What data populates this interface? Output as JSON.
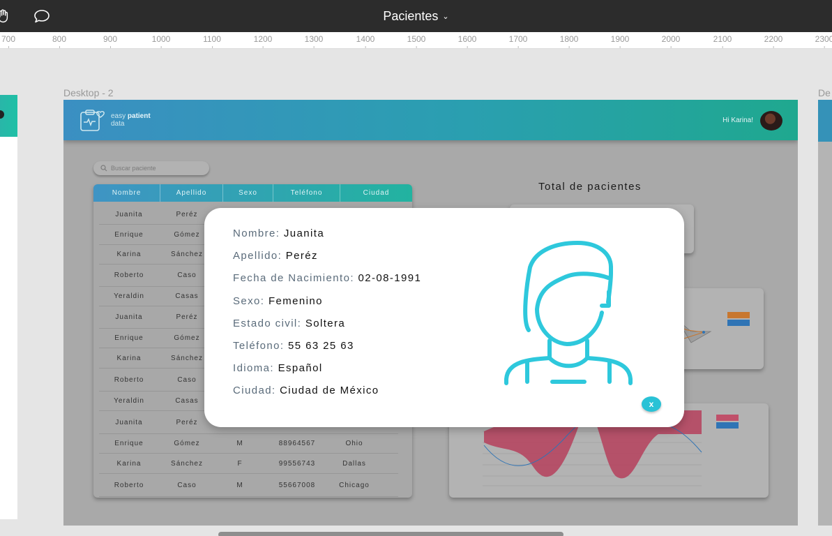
{
  "toolbar": {
    "title": "Pacientes",
    "caret": "⌄"
  },
  "ruler": [
    "700",
    "800",
    "900",
    "1000",
    "1100",
    "1200",
    "1300",
    "1400",
    "1500",
    "1600",
    "1700",
    "1800",
    "1900",
    "2000",
    "2100",
    "2200",
    "2300"
  ],
  "frames": {
    "main_label": "Desktop - 2",
    "right_label": "De"
  },
  "app": {
    "brand_line1_light": "easy ",
    "brand_line1_bold": "patient",
    "brand_line2": "data",
    "greeting": "Hi Karina!",
    "search_placeholder": "Buscar paciente",
    "table": {
      "headers": [
        "Nombre",
        "Apellido",
        "Sexo",
        "Teléfono",
        "Ciudad"
      ],
      "rows": [
        [
          "Juanita",
          "Peréz",
          "",
          "",
          ""
        ],
        [
          "Enrique",
          "Gómez",
          "",
          "",
          ""
        ],
        [
          "Karina",
          "Sánchez",
          "",
          "",
          ""
        ],
        [
          "Roberto",
          "Caso",
          "",
          "",
          ""
        ],
        [
          "Yeraldin",
          "Casas",
          "",
          "",
          ""
        ],
        [
          "Juanita",
          "Peréz",
          "",
          "",
          ""
        ],
        [
          "Enrique",
          "Gómez",
          "",
          "",
          ""
        ],
        [
          "Karina",
          "Sánchez",
          "",
          "",
          ""
        ],
        [
          "Roberto",
          "Caso",
          "",
          "",
          ""
        ],
        [
          "Yeraldin",
          "Casas",
          "",
          "",
          ""
        ],
        [
          "Juanita",
          "Peréz",
          "",
          "",
          ""
        ],
        [
          "Enrique",
          "Gómez",
          "M",
          "88964567",
          "Ohio"
        ],
        [
          "Karina",
          "Sánchez",
          "F",
          "99556743",
          "Dallas"
        ],
        [
          "Roberto",
          "Caso",
          "M",
          "55667008",
          "Chicago"
        ]
      ]
    },
    "total_title": "Total de pacientes"
  },
  "modal": {
    "fields": [
      {
        "label": "Nombre: ",
        "value": "Juanita"
      },
      {
        "label": "Apellido: ",
        "value": "Peréz"
      },
      {
        "label": "Fecha de Nacimiento: ",
        "value": "02-08-1991"
      },
      {
        "label": "Sexo: ",
        "value": "Femenino"
      },
      {
        "label": "Estado civil: ",
        "value": "Soltera"
      },
      {
        "label": "Teléfono: ",
        "value": "55 63 25 63"
      },
      {
        "label": "Idioma: ",
        "value": "Español"
      },
      {
        "label": "Ciudad: ",
        "value": "Ciudad de México"
      }
    ],
    "close_label": "x",
    "icon": "female-patient-icon",
    "icon_color": "#2ec8dc"
  },
  "colors": {
    "header_start": "#3b8fc2",
    "header_end": "#1fa88f",
    "chart_area": "#b5405c",
    "legend_orange": "#c8772f",
    "legend_blue": "#2f74b5",
    "legend_red": "#c0506a"
  }
}
